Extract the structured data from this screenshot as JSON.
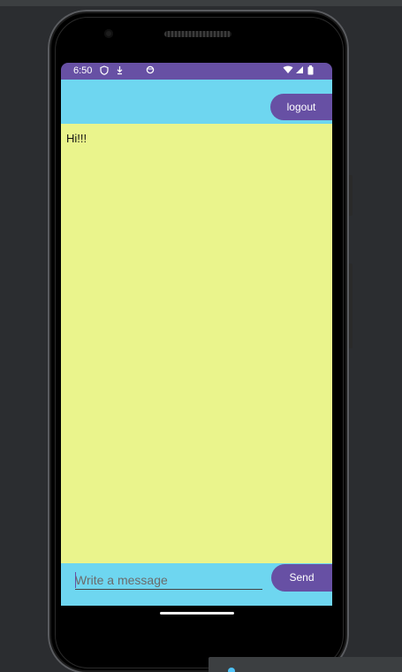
{
  "status_bar": {
    "time": "6:50",
    "icons": [
      "shield-icon",
      "download-icon",
      "circle-icon",
      "wifi-icon",
      "signal-icon",
      "battery-icon"
    ]
  },
  "header": {
    "logout_label": "logout"
  },
  "chat": {
    "messages": [
      "Hi!!!"
    ]
  },
  "composer": {
    "placeholder": "Write a message",
    "value": "",
    "send_label": "Send"
  },
  "colors": {
    "accent": "#6750a4",
    "app_bar": "#6ed6f0",
    "chat_background": "#eaf48c"
  }
}
